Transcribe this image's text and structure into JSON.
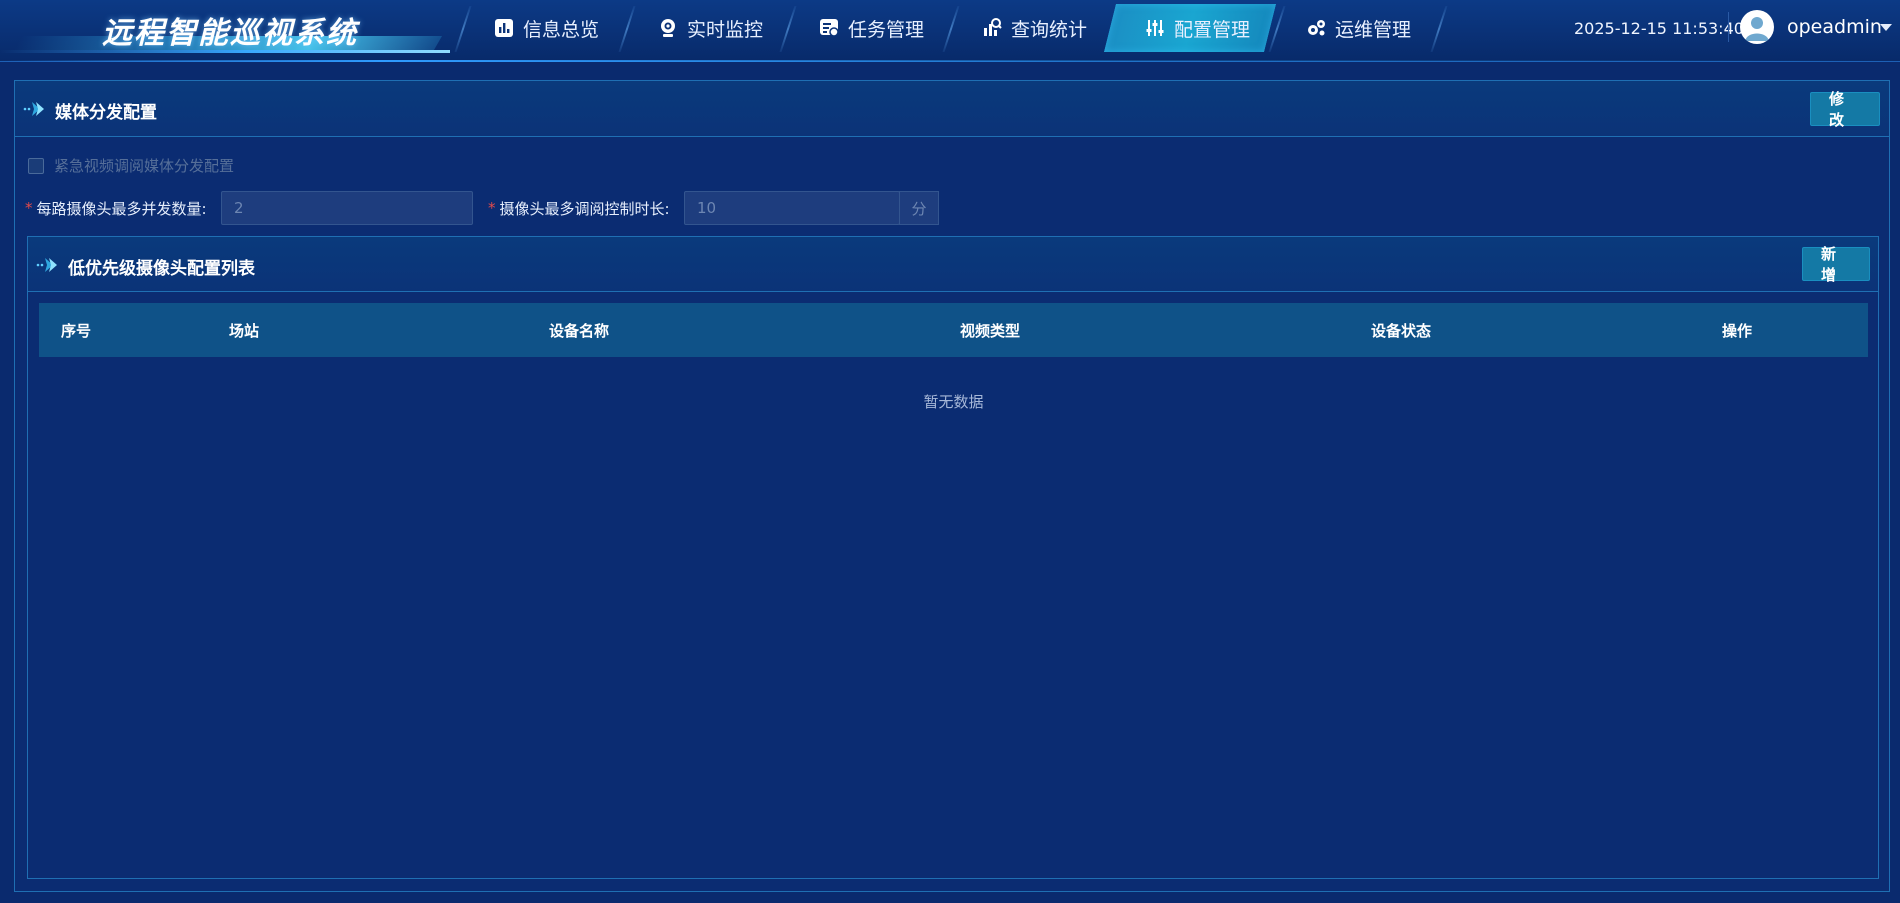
{
  "app": {
    "title": "远程智能巡视系统",
    "datetime": "2025-12-15 11:53:40",
    "username": "opeadmin"
  },
  "nav": [
    {
      "label": "信息总览",
      "icon": "bar-chart-icon"
    },
    {
      "label": "实时监控",
      "icon": "webcam-icon"
    },
    {
      "label": "任务管理",
      "icon": "task-icon"
    },
    {
      "label": "查询统计",
      "icon": "stats-icon"
    },
    {
      "label": "配置管理",
      "icon": "sliders-icon",
      "active": true
    },
    {
      "label": "运维管理",
      "icon": "gears-icon"
    }
  ],
  "media_config": {
    "title": "媒体分发配置",
    "modify_label": "修 改",
    "checkbox_label": "紧急视频调阅媒体分发配置",
    "checkbox_checked": false,
    "max_concurrent_label": "每路摄像头最多并发数量:",
    "max_concurrent_value": "2",
    "max_duration_label": "摄像头最多调阅控制时长:",
    "max_duration_value": "10",
    "max_duration_unit": "分"
  },
  "low_priority": {
    "title": "低优先级摄像头配置列表",
    "add_label": "新 增",
    "columns": [
      "序号",
      "场站",
      "设备名称",
      "视频类型",
      "设备状态",
      "操作"
    ],
    "rows": [],
    "empty_text": "暂无数据"
  },
  "colors": {
    "background": "#0a2a6e",
    "accent": "#1479a5",
    "nav_active": "#1aa6d1",
    "required": "#e24b4b"
  }
}
